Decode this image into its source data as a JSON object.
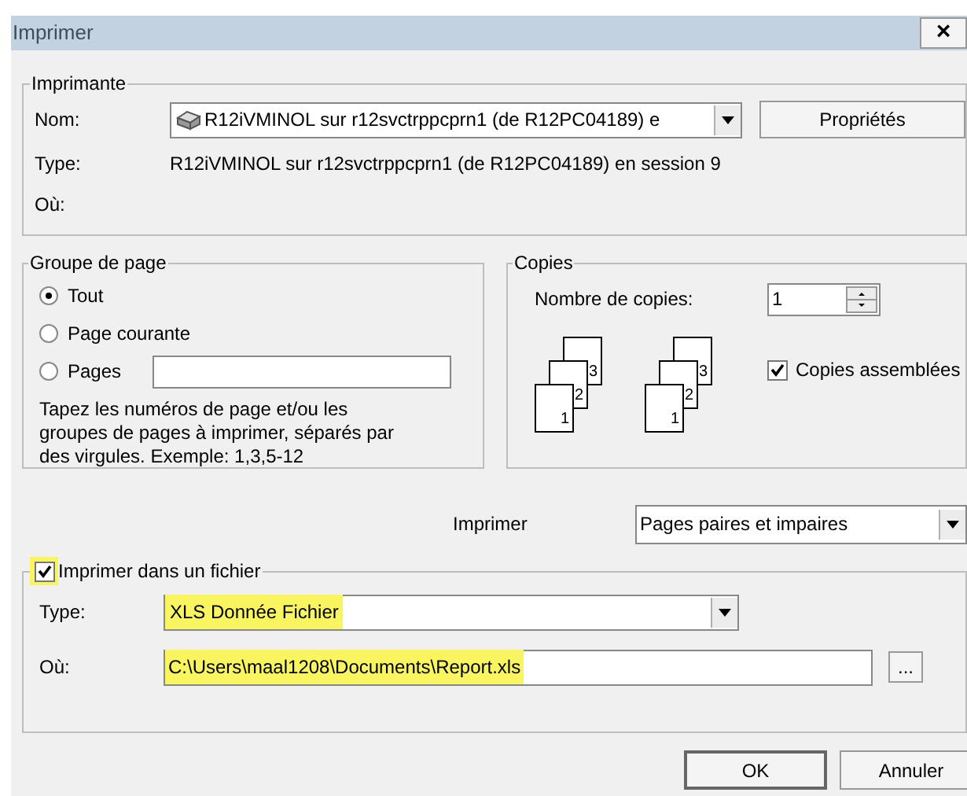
{
  "window": {
    "title": "Imprimer",
    "close": "×"
  },
  "printer": {
    "legend": "Imprimante",
    "name_label": "Nom:",
    "name_value": "R12iVMINOL sur r12svctrppcprn1 (de R12PC04189) e",
    "properties_button": "Propriétés",
    "type_label": "Type:",
    "type_value": "R12iVMINOL sur r12svctrppcprn1 (de R12PC04189) en session 9",
    "where_label": "Où:"
  },
  "page_range": {
    "legend": "Groupe de page",
    "options": [
      {
        "label": "Tout",
        "selected": true
      },
      {
        "label": "Page courante",
        "selected": false
      },
      {
        "label": "Pages",
        "selected": false
      }
    ],
    "hint": "Tapez les numéros de page et/ou les groupes de pages à imprimer, séparés par des virgules. Exemple: 1,3,5-12"
  },
  "copies": {
    "legend": "Copies",
    "count_label": "Nombre de copies:",
    "count_value": "1",
    "collate_label": "Copies assemblées",
    "collate": true,
    "stacks": [
      {
        "pages": [
          "1",
          "2",
          "3"
        ]
      },
      {
        "pages": [
          "1",
          "2",
          "3"
        ]
      }
    ]
  },
  "print_what": {
    "label": "Imprimer",
    "value": "Pages paires et impaires"
  },
  "print_to_file": {
    "label": "Imprimer dans un fichier",
    "checked": true,
    "highlighted": true,
    "type_label": "Type:",
    "type_value": "XLS Donnée Fichier",
    "type_highlighted": true,
    "where_label": "Où:",
    "where_value": "C:\\Users\\maal1208\\Documents\\Report.xls",
    "where_highlighted": true,
    "browse_button": "..."
  },
  "buttons": [
    {
      "label": "OK",
      "kind": "default"
    },
    {
      "label": "Annuler",
      "kind": "normal"
    }
  ]
}
